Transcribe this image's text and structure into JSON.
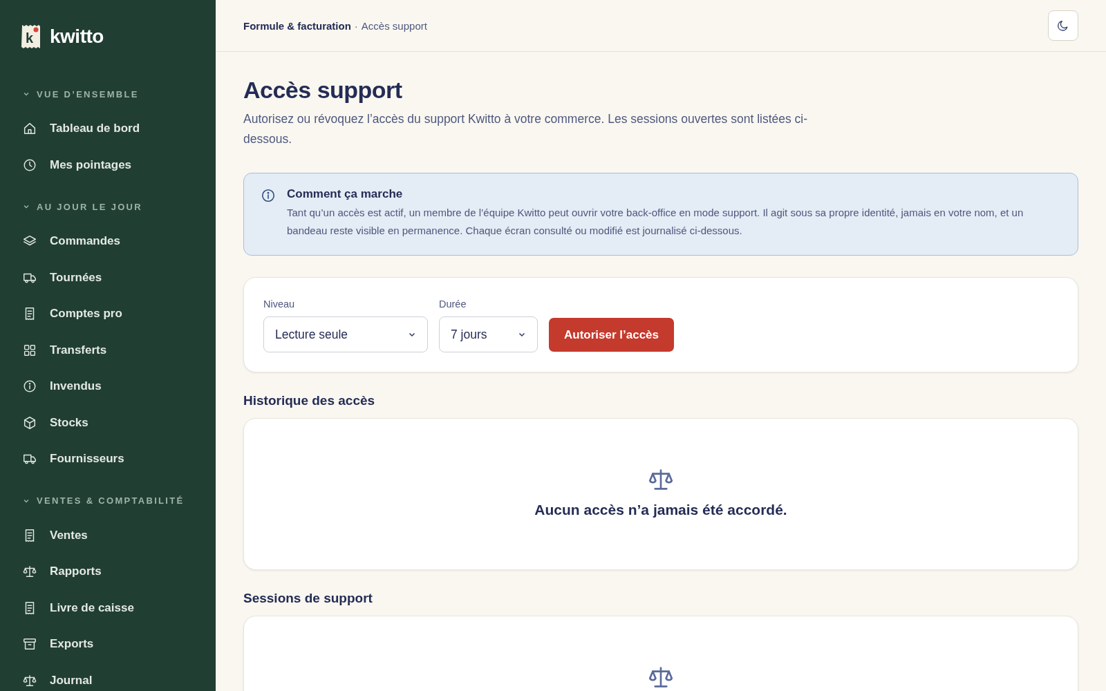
{
  "sidebar": {
    "brand": {
      "name": "kwitto",
      "mark": "k"
    },
    "sections": [
      {
        "title": "VUE D’ENSEMBLE",
        "expanded": true,
        "items": [
          {
            "label": "Tableau de bord",
            "kind": "home"
          },
          {
            "label": "Mes pointages",
            "kind": "clock"
          }
        ]
      },
      {
        "title": "AU JOUR LE JOUR",
        "expanded": true,
        "items": [
          {
            "label": "Commandes",
            "kind": "layers"
          },
          {
            "label": "Tournées",
            "kind": "truck"
          },
          {
            "label": "Comptes pro",
            "kind": "receipt"
          },
          {
            "label": "Transferts",
            "kind": "grid"
          },
          {
            "label": "Invendus",
            "kind": "info"
          },
          {
            "label": "Stocks",
            "kind": "box"
          },
          {
            "label": "Fournisseurs",
            "kind": "truck"
          }
        ]
      },
      {
        "title": "VENTES & COMPTABILITÉ",
        "expanded": true,
        "items": [
          {
            "label": "Ventes",
            "kind": "receipt"
          },
          {
            "label": "Rapports",
            "kind": "scale"
          },
          {
            "label": "Livre de caisse",
            "kind": "receipt"
          },
          {
            "label": "Exports",
            "kind": "archive"
          },
          {
            "label": "Journal",
            "kind": "scale"
          }
        ]
      }
    ]
  },
  "breadcrumb": {
    "parent": "Formule & facturation",
    "separator": "·",
    "current": "Accès support"
  },
  "page": {
    "title": "Accès support",
    "description": "Autorisez ou révoquez l’accès du support Kwitto à votre commerce. Les sessions ouvertes sont listées ci-dessous."
  },
  "info_box": {
    "title": "Comment ça marche",
    "text": "Tant qu’un accès est actif, un membre de l’équipe Kwitto peut ouvrir votre back-office en mode support. Il agit sous sa propre identité, jamais en votre nom, et un bandeau reste visible en permanence. Chaque écran consulté ou modifié est journalisé ci-dessous."
  },
  "grant_form": {
    "fields": [
      {
        "label": "Niveau",
        "value": "Lecture seule"
      },
      {
        "label": "Durée",
        "value": "7 jours"
      }
    ],
    "button": "Autoriser l’accès"
  },
  "sections": [
    {
      "title": "Historique des accès",
      "empty_message": "Aucun accès n’a jamais été accordé."
    },
    {
      "title": "Sessions de support"
    }
  ]
}
